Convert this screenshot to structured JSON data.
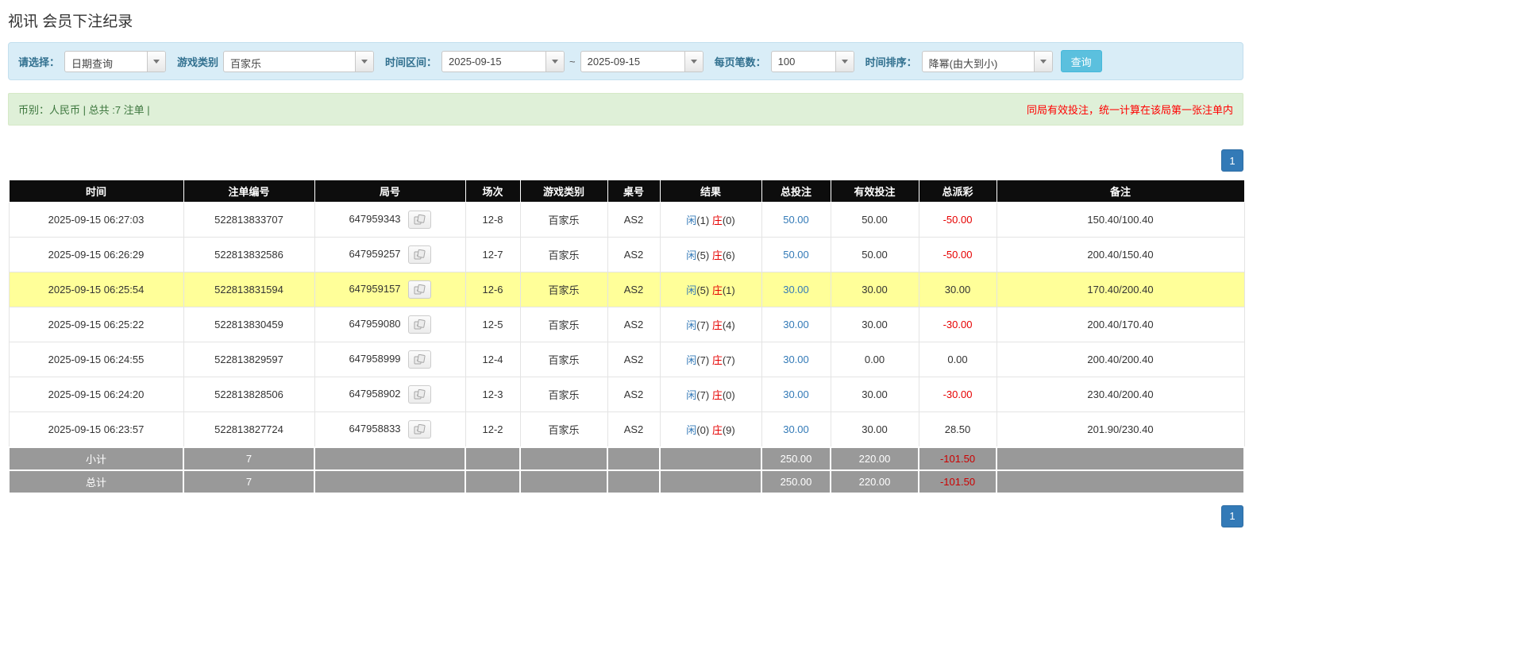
{
  "page": {
    "title": "视讯 会员下注纪录"
  },
  "filters": {
    "query_label": "请选择：",
    "query_value": "日期查询",
    "game_label": "游戏类别",
    "game_value": "百家乐",
    "range_label": "时间区间：",
    "date_from": "2025-09-15",
    "range_separator": "~",
    "date_to": "2025-09-15",
    "page_size_label": "每页笔数：",
    "page_size_value": "100",
    "sort_label": "时间排序：",
    "sort_value": "降幂(由大到小)",
    "search_button": "查询"
  },
  "summary": {
    "left": "币别：人民币 | 总共 :7 注单 |",
    "note": "同局有效投注，统一计算在该局第一张注单内"
  },
  "pagination": {
    "page": "1"
  },
  "icons": {
    "dropdown": "chevron-down-icon",
    "round_detail": "cards-icon"
  },
  "colors": {
    "filter_bar_bg": "#d9edf7",
    "summary_bg": "#dff0d8",
    "accent_button": "#5bc0de",
    "pagination_blue": "#337ab7",
    "header_bg": "#0d0d0d",
    "highlight_row": "#ffff99",
    "link_blue": "#337ab7",
    "player_blue": "#3379b7",
    "banker_red": "#e60000",
    "negative_red": "#e60000",
    "footer_bg": "#999999"
  },
  "table": {
    "headers": [
      "时间",
      "注单编号",
      "局号",
      "场次",
      "游戏类别",
      "桌号",
      "结果",
      "总投注",
      "有效投注",
      "总派彩",
      "备注"
    ],
    "rows": [
      {
        "time": "2025-09-15 06:27:03",
        "bet_id": "522813833707",
        "round_id": "647959343",
        "session": "12-8",
        "game": "百家乐",
        "table_no": "AS2",
        "result": {
          "player_label": "闲",
          "player_value": "(1)",
          "banker_label": "庄",
          "banker_value": "(0)"
        },
        "total_bet": "50.00",
        "valid_bet": "50.00",
        "payout": "-50.00",
        "note": "150.40/100.40",
        "highlight": false
      },
      {
        "time": "2025-09-15 06:26:29",
        "bet_id": "522813832586",
        "round_id": "647959257",
        "session": "12-7",
        "game": "百家乐",
        "table_no": "AS2",
        "result": {
          "player_label": "闲",
          "player_value": "(5)",
          "banker_label": "庄",
          "banker_value": "(6)"
        },
        "total_bet": "50.00",
        "valid_bet": "50.00",
        "payout": "-50.00",
        "note": "200.40/150.40",
        "highlight": false
      },
      {
        "time": "2025-09-15 06:25:54",
        "bet_id": "522813831594",
        "round_id": "647959157",
        "session": "12-6",
        "game": "百家乐",
        "table_no": "AS2",
        "result": {
          "player_label": "闲",
          "player_value": "(5)",
          "banker_label": "庄",
          "banker_value": "(1)"
        },
        "total_bet": "30.00",
        "valid_bet": "30.00",
        "payout": "30.00",
        "note": "170.40/200.40",
        "highlight": true
      },
      {
        "time": "2025-09-15 06:25:22",
        "bet_id": "522813830459",
        "round_id": "647959080",
        "session": "12-5",
        "game": "百家乐",
        "table_no": "AS2",
        "result": {
          "player_label": "闲",
          "player_value": "(7)",
          "banker_label": "庄",
          "banker_value": "(4)"
        },
        "total_bet": "30.00",
        "valid_bet": "30.00",
        "payout": "-30.00",
        "note": "200.40/170.40",
        "highlight": false
      },
      {
        "time": "2025-09-15 06:24:55",
        "bet_id": "522813829597",
        "round_id": "647958999",
        "session": "12-4",
        "game": "百家乐",
        "table_no": "AS2",
        "result": {
          "player_label": "闲",
          "player_value": "(7)",
          "banker_label": "庄",
          "banker_value": "(7)"
        },
        "total_bet": "30.00",
        "valid_bet": "0.00",
        "payout": "0.00",
        "note": "200.40/200.40",
        "highlight": false
      },
      {
        "time": "2025-09-15 06:24:20",
        "bet_id": "522813828506",
        "round_id": "647958902",
        "session": "12-3",
        "game": "百家乐",
        "table_no": "AS2",
        "result": {
          "player_label": "闲",
          "player_value": "(7)",
          "banker_label": "庄",
          "banker_value": "(0)"
        },
        "total_bet": "30.00",
        "valid_bet": "30.00",
        "payout": "-30.00",
        "note": "230.40/200.40",
        "highlight": false
      },
      {
        "time": "2025-09-15 06:23:57",
        "bet_id": "522813827724",
        "round_id": "647958833",
        "session": "12-2",
        "game": "百家乐",
        "table_no": "AS2",
        "result": {
          "player_label": "闲",
          "player_value": "(0)",
          "banker_label": "庄",
          "banker_value": "(9)"
        },
        "total_bet": "30.00",
        "valid_bet": "30.00",
        "payout": "28.50",
        "note": "201.90/230.40",
        "highlight": false
      }
    ],
    "footer_rows": [
      {
        "label": "小计",
        "count": "7",
        "total_bet": "250.00",
        "valid_bet": "220.00",
        "payout": "-101.50"
      },
      {
        "label": "总计",
        "count": "7",
        "total_bet": "250.00",
        "valid_bet": "220.00",
        "payout": "-101.50"
      }
    ]
  }
}
